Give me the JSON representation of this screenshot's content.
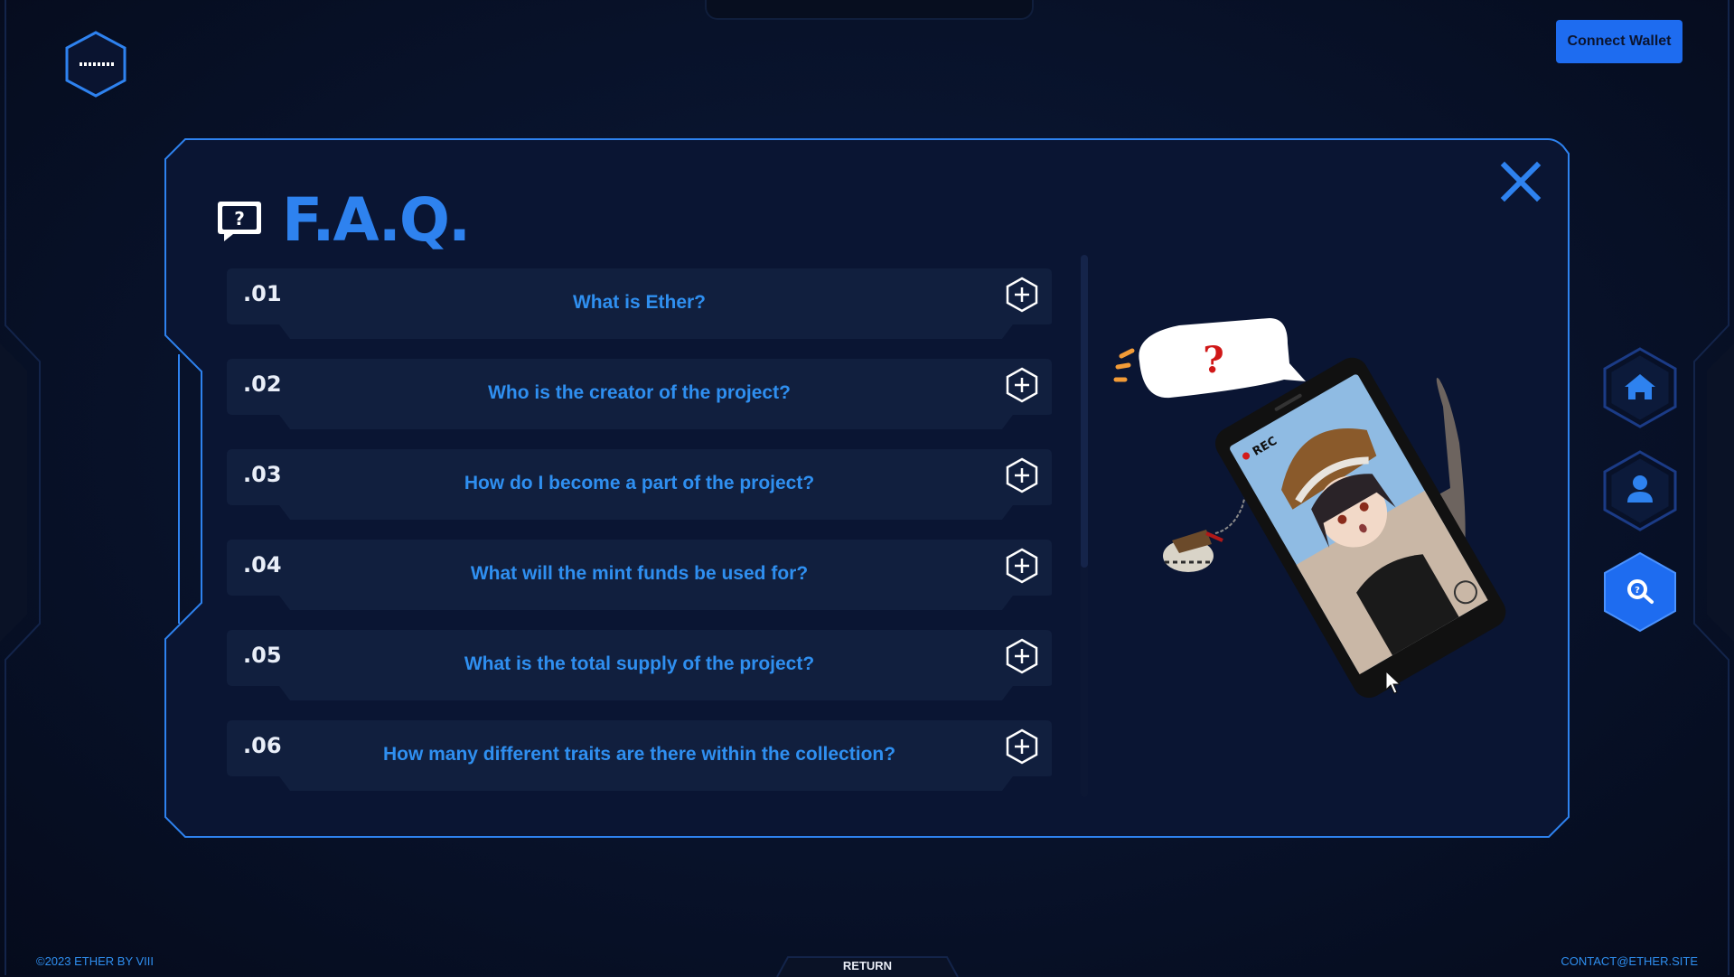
{
  "header": {
    "menu_icon": "dots-menu-icon",
    "connect_wallet": "Connect Wallet"
  },
  "faq": {
    "title": "F.A.Q.",
    "icon": "question-chat-icon",
    "close_icon": "close-icon",
    "items": [
      {
        "num": ".01",
        "question": "What is Ether?"
      },
      {
        "num": ".02",
        "question": "Who is the creator of the project?"
      },
      {
        "num": ".03",
        "question": "How do I become a part of the project?"
      },
      {
        "num": ".04",
        "question": "What will the mint funds be used for?"
      },
      {
        "num": ".05",
        "question": "What is the total supply of the project?"
      },
      {
        "num": ".06",
        "question": "How many different traits are there within the collection?"
      }
    ]
  },
  "illustration": {
    "bubble_text": "?",
    "rec_label": "REC"
  },
  "side_nav": [
    {
      "icon": "home-icon"
    },
    {
      "icon": "user-icon"
    },
    {
      "icon": "faq-icon",
      "active": true
    }
  ],
  "footer": {
    "copyright": "©2023 ETHER BY VIII",
    "return": "RETURN",
    "contact": "CONTACT@ETHER.SITE"
  },
  "colors": {
    "accent": "#2e82ef",
    "background": "#08122a",
    "card": "#111f3e"
  }
}
